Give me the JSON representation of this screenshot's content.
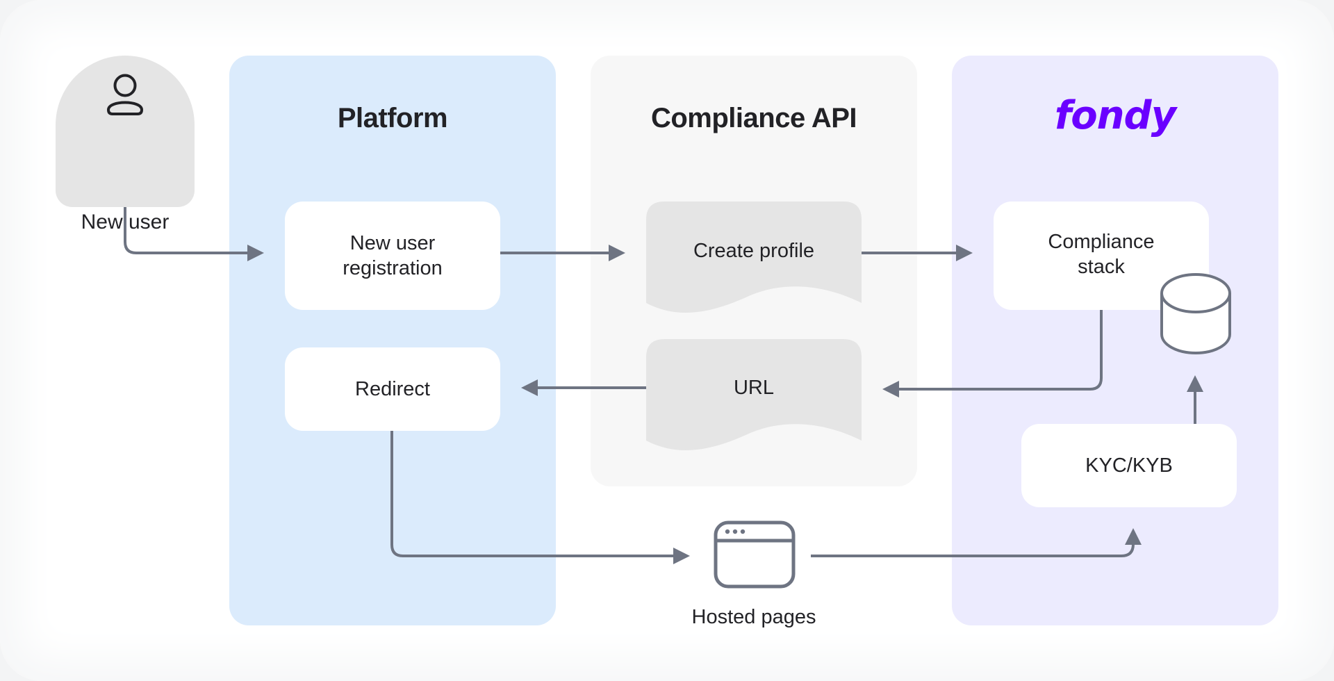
{
  "actors": {
    "new_user": {
      "label": "New user",
      "icon": "user-icon"
    }
  },
  "lanes": {
    "platform": {
      "title": "Platform",
      "color": "#dbebfc"
    },
    "compliance_api": {
      "title": "Compliance API",
      "color": "#f7f7f7"
    },
    "fondy": {
      "title": "fondy",
      "color": "#ecebfe",
      "brand_color": "#6a00ff"
    }
  },
  "nodes": {
    "new_user_registration": {
      "line1": "New user",
      "line2": "registration"
    },
    "redirect": {
      "label": "Redirect"
    },
    "create_profile": {
      "label": "Create profile",
      "shape": "document"
    },
    "url": {
      "label": "URL",
      "shape": "document"
    },
    "compliance_stack": {
      "line1": "Compliance",
      "line2": "stack"
    },
    "database": {
      "icon": "database-icon"
    },
    "kyc_kyb": {
      "label": "KYC/KYB"
    },
    "hosted_pages": {
      "label": "Hosted pages",
      "icon": "browser-window-icon"
    }
  },
  "edges": [
    {
      "from": "New user",
      "to": "New user registration"
    },
    {
      "from": "New user registration",
      "to": "Create profile"
    },
    {
      "from": "Create profile",
      "to": "Compliance stack"
    },
    {
      "from": "Compliance stack",
      "to": "URL"
    },
    {
      "from": "URL",
      "to": "Redirect"
    },
    {
      "from": "Redirect",
      "to": "Hosted pages"
    },
    {
      "from": "Hosted pages",
      "to": "KYC/KYB"
    },
    {
      "from": "KYC/KYB",
      "to": "Database"
    }
  ],
  "colors": {
    "connector": "#6e7482",
    "text": "#222226",
    "document_fill": "#e5e5e5",
    "actor_fill": "#e5e5e5"
  }
}
